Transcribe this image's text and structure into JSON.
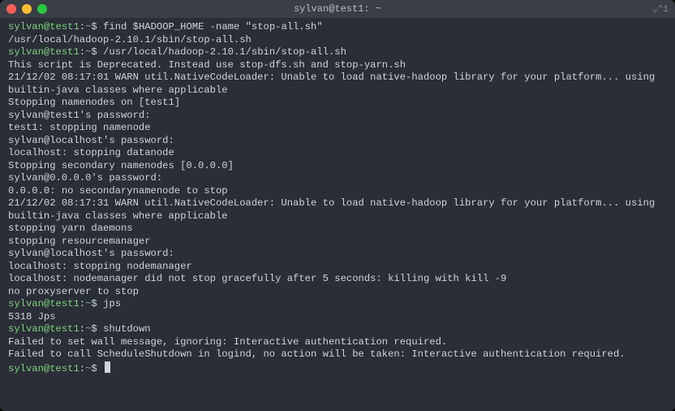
{
  "window": {
    "title": "sylvan@test1: ~",
    "title_right": "⌄⌃1"
  },
  "prompt": {
    "userhost": "sylvan@test1",
    "colon": ":",
    "cwd": "~",
    "sigil": "$"
  },
  "entries": [
    {
      "kind": "cmd",
      "text": "find $HADOOP_HOME -name \"stop-all.sh\""
    },
    {
      "kind": "out",
      "text": "/usr/local/hadoop-2.10.1/sbin/stop-all.sh"
    },
    {
      "kind": "cmd",
      "text": "/usr/local/hadoop-2.10.1/sbin/stop-all.sh"
    },
    {
      "kind": "out",
      "text": "This script is Deprecated. Instead use stop-dfs.sh and stop-yarn.sh"
    },
    {
      "kind": "out",
      "text": "21/12/02 08:17:01 WARN util.NativeCodeLoader: Unable to load native-hadoop library for your platform... using builtin-java classes where applicable"
    },
    {
      "kind": "out",
      "text": "Stopping namenodes on [test1]"
    },
    {
      "kind": "out",
      "text": "sylvan@test1's password:"
    },
    {
      "kind": "out",
      "text": "test1: stopping namenode"
    },
    {
      "kind": "out",
      "text": "sylvan@localhost's password:"
    },
    {
      "kind": "out",
      "text": "localhost: stopping datanode"
    },
    {
      "kind": "out",
      "text": "Stopping secondary namenodes [0.0.0.0]"
    },
    {
      "kind": "out",
      "text": "sylvan@0.0.0.0's password:"
    },
    {
      "kind": "out",
      "text": "0.0.0.0: no secondarynamenode to stop"
    },
    {
      "kind": "out",
      "text": "21/12/02 08:17:31 WARN util.NativeCodeLoader: Unable to load native-hadoop library for your platform... using builtin-java classes where applicable"
    },
    {
      "kind": "out",
      "text": "stopping yarn daemons"
    },
    {
      "kind": "out",
      "text": "stopping resourcemanager"
    },
    {
      "kind": "out",
      "text": "sylvan@localhost's password:"
    },
    {
      "kind": "out",
      "text": "localhost: stopping nodemanager"
    },
    {
      "kind": "out",
      "text": "localhost: nodemanager did not stop gracefully after 5 seconds: killing with kill -9"
    },
    {
      "kind": "out",
      "text": "no proxyserver to stop"
    },
    {
      "kind": "cmd",
      "text": "jps"
    },
    {
      "kind": "out",
      "text": "5318 Jps"
    },
    {
      "kind": "cmd",
      "text": "shutdown"
    },
    {
      "kind": "out",
      "text": "Failed to set wall message, ignoring: Interactive authentication required."
    },
    {
      "kind": "out",
      "text": "Failed to call ScheduleShutdown in logind, no action will be taken: Interactive authentication required."
    },
    {
      "kind": "cursor"
    }
  ]
}
